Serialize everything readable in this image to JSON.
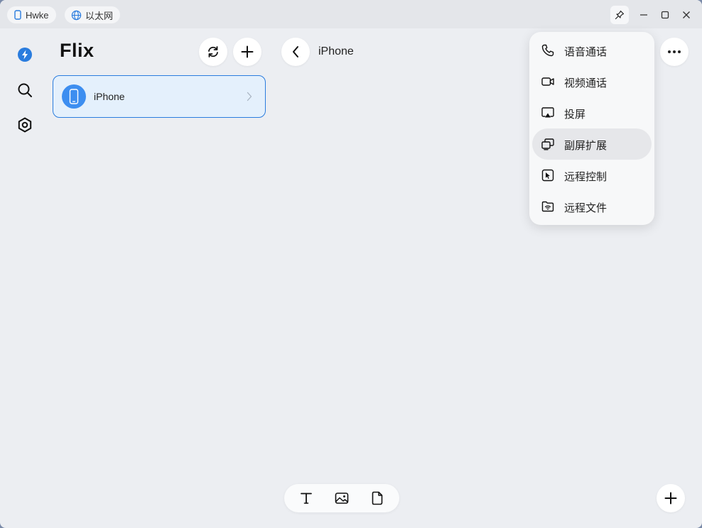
{
  "titlebar": {
    "device_pill": "Hwke",
    "network_pill": "以太网"
  },
  "sidebar": {
    "app_name": "Flix",
    "devices": [
      {
        "name": "iPhone"
      }
    ]
  },
  "chat": {
    "title": "iPhone"
  },
  "menu": {
    "items": [
      {
        "label": "语音通话",
        "icon": "phone-icon"
      },
      {
        "label": "视频通话",
        "icon": "video-icon"
      },
      {
        "label": "投屏",
        "icon": "screen-cast-icon"
      },
      {
        "label": "副屏扩展",
        "icon": "extend-screen-icon"
      },
      {
        "label": "远程控制",
        "icon": "remote-control-icon"
      },
      {
        "label": "远程文件",
        "icon": "remote-file-icon"
      }
    ],
    "active_index": 3
  },
  "colors": {
    "accent": "#2a7cde",
    "card_bg": "#e4f0fc",
    "window_bg": "#eceef2"
  }
}
